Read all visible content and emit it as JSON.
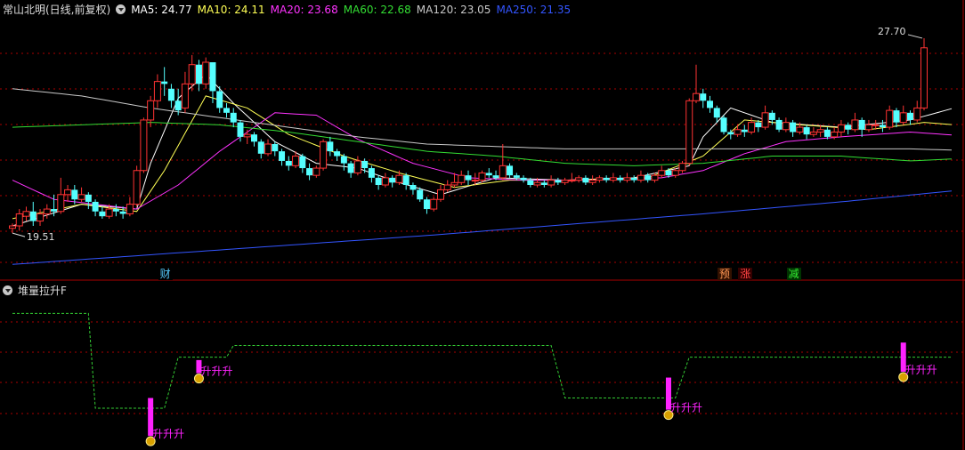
{
  "header": {
    "title": "常山北明(日线,前复权)",
    "ma": [
      {
        "label": "MA5: 24.77",
        "color": "#ffffff"
      },
      {
        "label": "MA10: 24.11",
        "color": "#ffff55"
      },
      {
        "label": "MA20: 23.68",
        "color": "#ff33ff"
      },
      {
        "label": "MA60: 22.68",
        "color": "#33dd33"
      },
      {
        "label": "MA120: 23.05",
        "color": "#c8c8c8"
      },
      {
        "label": "MA250: 21.35",
        "color": "#3355ff"
      }
    ]
  },
  "sub_header": {
    "title": "堆量拉升F"
  },
  "markers": [
    {
      "text": "财",
      "color": "#55ccff",
      "bg": "#000",
      "x_index": 22
    },
    {
      "text": "预",
      "color": "#ff9955",
      "bg": "#331100",
      "x_index": 103
    },
    {
      "text": "涨",
      "color": "#ff4444",
      "bg": "#330000",
      "x_index": 106
    },
    {
      "text": "减",
      "color": "#33ee33",
      "bg": "#003300",
      "x_index": 113
    }
  ],
  "annotations": {
    "high": "27.70",
    "low": "19.51",
    "signal_text": "升升升"
  },
  "colors": {
    "up": "#ff3333",
    "down": "#55ffff",
    "grid": "#aa0000",
    "ma5": "#ffffff",
    "ma10": "#ffff55",
    "ma20": "#ff33ff",
    "ma60": "#33dd33",
    "ma120": "#c8c8c8",
    "ma250": "#3355ff",
    "step": "#33cc33",
    "bar": "#ff22ff"
  },
  "chart_data": {
    "type": "candlestick",
    "price_range": [
      18.2,
      28.4
    ],
    "candles": [
      [
        19.8,
        19.9,
        20.0,
        19.6
      ],
      [
        19.9,
        20.4,
        20.6,
        19.7
      ],
      [
        20.3,
        20.5,
        20.7,
        20.1
      ],
      [
        20.5,
        20.1,
        20.9,
        19.9
      ],
      [
        20.1,
        20.4,
        20.6,
        19.9
      ],
      [
        20.4,
        20.6,
        20.8,
        20.2
      ],
      [
        20.6,
        20.5,
        21.2,
        20.3
      ],
      [
        20.5,
        21.2,
        21.9,
        20.4
      ],
      [
        21.2,
        21.4,
        21.6,
        20.9
      ],
      [
        21.4,
        21.0,
        21.6,
        20.8
      ],
      [
        21.0,
        21.2,
        21.5,
        20.9
      ],
      [
        21.2,
        20.9,
        21.3,
        20.6
      ],
      [
        20.9,
        20.5,
        21.0,
        20.3
      ],
      [
        20.5,
        20.3,
        20.7,
        20.2
      ],
      [
        20.3,
        20.6,
        20.8,
        20.2
      ],
      [
        20.6,
        20.5,
        20.8,
        20.3
      ],
      [
        20.5,
        20.4,
        20.7,
        20.2
      ],
      [
        20.4,
        20.8,
        21.1,
        20.3
      ],
      [
        20.8,
        22.2,
        22.4,
        20.7
      ],
      [
        22.2,
        24.3,
        24.4,
        22.1
      ],
      [
        24.3,
        25.1,
        25.3,
        24.0
      ],
      [
        25.1,
        25.9,
        26.2,
        24.8
      ],
      [
        25.9,
        25.8,
        26.5,
        25.3
      ],
      [
        25.6,
        25.1,
        25.8,
        24.8
      ],
      [
        25.1,
        24.7,
        25.6,
        24.5
      ],
      [
        24.8,
        25.8,
        26.3,
        24.6
      ],
      [
        25.8,
        26.6,
        27.0,
        25.5
      ],
      [
        26.6,
        25.8,
        26.8,
        25.5
      ],
      [
        25.8,
        26.7,
        26.9,
        25.6
      ],
      [
        26.7,
        25.5,
        26.7,
        25.0
      ],
      [
        25.5,
        24.8,
        25.7,
        24.6
      ],
      [
        24.8,
        24.6,
        25.0,
        24.4
      ],
      [
        24.6,
        24.2,
        24.8,
        24.0
      ],
      [
        24.2,
        23.6,
        24.3,
        23.4
      ],
      [
        23.6,
        23.7,
        23.9,
        23.3
      ],
      [
        23.7,
        23.4,
        23.8,
        23.2
      ],
      [
        23.4,
        22.9,
        23.5,
        22.7
      ],
      [
        22.9,
        23.3,
        23.5,
        22.8
      ],
      [
        23.3,
        23.0,
        23.4,
        22.8
      ],
      [
        23.0,
        22.6,
        23.1,
        22.4
      ],
      [
        22.6,
        22.4,
        22.8,
        22.2
      ],
      [
        22.4,
        22.8,
        23.0,
        22.3
      ],
      [
        22.8,
        22.3,
        22.9,
        22.1
      ],
      [
        22.3,
        22.0,
        22.5,
        21.8
      ],
      [
        22.0,
        22.3,
        22.4,
        21.9
      ],
      [
        22.3,
        23.4,
        23.5,
        22.2
      ],
      [
        23.4,
        23.0,
        23.6,
        22.8
      ],
      [
        23.0,
        22.8,
        23.1,
        22.6
      ],
      [
        22.8,
        22.5,
        22.9,
        22.2
      ],
      [
        22.5,
        22.1,
        22.6,
        21.9
      ],
      [
        22.1,
        22.6,
        22.8,
        22.0
      ],
      [
        22.6,
        22.3,
        22.7,
        22.1
      ],
      [
        22.3,
        21.9,
        22.4,
        21.7
      ],
      [
        21.9,
        21.6,
        22.0,
        21.4
      ],
      [
        21.6,
        21.9,
        22.1,
        21.5
      ],
      [
        21.9,
        21.7,
        22.0,
        21.5
      ],
      [
        21.7,
        22.0,
        22.2,
        21.6
      ],
      [
        22.0,
        21.6,
        22.1,
        21.4
      ],
      [
        21.6,
        21.4,
        21.7,
        21.2
      ],
      [
        21.4,
        21.0,
        21.5,
        20.9
      ],
      [
        21.0,
        20.6,
        21.1,
        20.4
      ],
      [
        20.6,
        21.0,
        21.1,
        20.5
      ],
      [
        21.0,
        21.4,
        21.6,
        20.9
      ],
      [
        21.4,
        21.6,
        21.8,
        21.3
      ],
      [
        21.6,
        21.7,
        22.1,
        21.5
      ],
      [
        21.7,
        22.0,
        22.2,
        21.6
      ],
      [
        22.0,
        21.8,
        22.2,
        21.6
      ],
      [
        21.8,
        21.8,
        22.1,
        21.6
      ],
      [
        21.8,
        22.1,
        22.2,
        21.7
      ],
      [
        22.1,
        22.0,
        22.3,
        21.9
      ],
      [
        22.0,
        21.9,
        22.2,
        21.8
      ],
      [
        21.9,
        22.4,
        23.3,
        21.8
      ],
      [
        22.4,
        22.0,
        22.5,
        21.9
      ],
      [
        22.0,
        21.9,
        22.1,
        21.8
      ],
      [
        21.9,
        21.8,
        22.0,
        21.7
      ],
      [
        21.8,
        21.6,
        21.9,
        21.5
      ],
      [
        21.6,
        21.7,
        21.9,
        21.5
      ],
      [
        21.7,
        21.6,
        21.8,
        21.5
      ],
      [
        21.6,
        21.8,
        22.0,
        21.5
      ],
      [
        21.8,
        21.7,
        21.9,
        21.6
      ],
      [
        21.7,
        21.8,
        21.9,
        21.6
      ],
      [
        21.8,
        21.8,
        22.1,
        21.7
      ],
      [
        21.8,
        21.9,
        22.0,
        21.7
      ],
      [
        21.9,
        21.7,
        22.0,
        21.6
      ],
      [
        21.7,
        21.8,
        22.0,
        21.6
      ],
      [
        21.8,
        21.9,
        22.0,
        21.7
      ],
      [
        21.9,
        21.8,
        22.0,
        21.7
      ],
      [
        21.8,
        21.9,
        22.1,
        21.7
      ],
      [
        21.9,
        21.8,
        22.0,
        21.7
      ],
      [
        21.8,
        21.9,
        22.1,
        21.7
      ],
      [
        21.9,
        21.8,
        22.0,
        21.7
      ],
      [
        21.8,
        22.0,
        22.2,
        21.7
      ],
      [
        22.0,
        21.8,
        22.1,
        21.7
      ],
      [
        21.8,
        22.0,
        22.1,
        21.7
      ],
      [
        22.0,
        22.2,
        22.4,
        21.9
      ],
      [
        22.2,
        22.0,
        22.3,
        21.9
      ],
      [
        22.0,
        22.2,
        22.3,
        21.9
      ],
      [
        22.2,
        22.5,
        22.6,
        22.1
      ],
      [
        22.5,
        25.1,
        25.2,
        22.4
      ],
      [
        25.1,
        25.4,
        26.6,
        25.0
      ],
      [
        25.4,
        25.1,
        25.6,
        24.8
      ],
      [
        25.1,
        24.8,
        25.3,
        24.6
      ],
      [
        24.8,
        24.4,
        24.9,
        24.2
      ],
      [
        24.4,
        23.8,
        24.5,
        23.7
      ],
      [
        23.8,
        23.7,
        23.9,
        23.5
      ],
      [
        23.7,
        23.9,
        24.1,
        23.6
      ],
      [
        23.9,
        23.8,
        24.1,
        23.6
      ],
      [
        23.8,
        24.2,
        24.4,
        23.7
      ],
      [
        24.2,
        24.0,
        24.3,
        23.8
      ],
      [
        24.0,
        24.6,
        24.9,
        23.9
      ],
      [
        24.6,
        24.3,
        24.7,
        24.1
      ],
      [
        24.3,
        23.9,
        24.4,
        23.8
      ],
      [
        23.9,
        24.2,
        24.4,
        23.8
      ],
      [
        24.2,
        23.8,
        24.3,
        23.6
      ],
      [
        23.8,
        24.0,
        24.2,
        23.7
      ],
      [
        24.0,
        23.7,
        24.1,
        23.5
      ],
      [
        23.7,
        23.8,
        24.0,
        23.6
      ],
      [
        23.8,
        23.9,
        24.1,
        23.6
      ],
      [
        23.9,
        23.6,
        24.0,
        23.5
      ],
      [
        23.6,
        23.8,
        24.0,
        23.5
      ],
      [
        23.8,
        24.1,
        24.3,
        23.6
      ],
      [
        24.1,
        23.9,
        24.2,
        23.7
      ],
      [
        23.9,
        24.3,
        24.6,
        23.8
      ],
      [
        24.3,
        23.9,
        24.4,
        23.6
      ],
      [
        23.9,
        24.1,
        24.3,
        23.8
      ],
      [
        24.1,
        24.1,
        24.3,
        23.9
      ],
      [
        24.1,
        24.0,
        24.3,
        23.8
      ],
      [
        24.0,
        24.7,
        24.9,
        23.9
      ],
      [
        24.7,
        24.2,
        24.8,
        24.0
      ],
      [
        24.2,
        24.6,
        24.9,
        24.1
      ],
      [
        24.6,
        24.3,
        24.7,
        24.1
      ],
      [
        24.3,
        24.8,
        25.1,
        24.2
      ],
      [
        24.8,
        27.3,
        27.7,
        24.7
      ]
    ],
    "ma_lines": [
      {
        "name": "MA5",
        "color": "#ffffff",
        "values": [
          [
            0,
            19.9
          ],
          [
            10,
            20.8
          ],
          [
            18,
            20.6
          ],
          [
            20,
            22.5
          ],
          [
            24,
            25.2
          ],
          [
            28,
            26.2
          ],
          [
            32,
            25.0
          ],
          [
            38,
            23.4
          ],
          [
            44,
            22.5
          ],
          [
            50,
            22.3
          ],
          [
            56,
            21.7
          ],
          [
            62,
            21.2
          ],
          [
            70,
            21.9
          ],
          [
            80,
            21.8
          ],
          [
            90,
            21.9
          ],
          [
            98,
            22.4
          ],
          [
            100,
            23.6
          ],
          [
            104,
            24.8
          ],
          [
            110,
            24.2
          ],
          [
            120,
            24.0
          ],
          [
            130,
            24.3
          ],
          [
            136,
            24.77
          ]
        ]
      },
      {
        "name": "MA10",
        "color": "#ffff55",
        "values": [
          [
            0,
            20.2
          ],
          [
            10,
            20.8
          ],
          [
            18,
            20.5
          ],
          [
            22,
            22.2
          ],
          [
            28,
            25.3
          ],
          [
            34,
            24.8
          ],
          [
            40,
            23.7
          ],
          [
            48,
            22.8
          ],
          [
            56,
            22.1
          ],
          [
            64,
            21.5
          ],
          [
            72,
            21.8
          ],
          [
            82,
            21.8
          ],
          [
            92,
            21.9
          ],
          [
            100,
            22.8
          ],
          [
            106,
            24.3
          ],
          [
            114,
            24.1
          ],
          [
            124,
            23.9
          ],
          [
            132,
            24.2
          ],
          [
            136,
            24.11
          ]
        ]
      },
      {
        "name": "MA20",
        "color": "#ff33ff",
        "values": [
          [
            0,
            21.8
          ],
          [
            6,
            21.0
          ],
          [
            12,
            20.8
          ],
          [
            18,
            20.6
          ],
          [
            24,
            21.6
          ],
          [
            30,
            23.0
          ],
          [
            38,
            24.6
          ],
          [
            44,
            24.5
          ],
          [
            50,
            23.5
          ],
          [
            58,
            22.5
          ],
          [
            66,
            21.9
          ],
          [
            74,
            21.8
          ],
          [
            84,
            21.8
          ],
          [
            94,
            21.9
          ],
          [
            100,
            22.2
          ],
          [
            106,
            22.9
          ],
          [
            112,
            23.4
          ],
          [
            120,
            23.6
          ],
          [
            130,
            23.8
          ],
          [
            136,
            23.68
          ]
        ]
      },
      {
        "name": "MA60",
        "color": "#33dd33",
        "values": [
          [
            0,
            24.0
          ],
          [
            10,
            24.1
          ],
          [
            20,
            24.2
          ],
          [
            30,
            24.1
          ],
          [
            40,
            23.8
          ],
          [
            50,
            23.4
          ],
          [
            60,
            23.0
          ],
          [
            70,
            22.8
          ],
          [
            80,
            22.5
          ],
          [
            90,
            22.4
          ],
          [
            100,
            22.5
          ],
          [
            110,
            22.8
          ],
          [
            120,
            22.8
          ],
          [
            130,
            22.6
          ],
          [
            136,
            22.68
          ]
        ]
      },
      {
        "name": "MA120",
        "color": "#c8c8c8",
        "values": [
          [
            0,
            25.6
          ],
          [
            10,
            25.3
          ],
          [
            20,
            24.8
          ],
          [
            30,
            24.4
          ],
          [
            40,
            24.0
          ],
          [
            50,
            23.6
          ],
          [
            60,
            23.3
          ],
          [
            70,
            23.2
          ],
          [
            80,
            23.1
          ],
          [
            90,
            23.1
          ],
          [
            100,
            23.1
          ],
          [
            110,
            23.1
          ],
          [
            120,
            23.1
          ],
          [
            130,
            23.1
          ],
          [
            136,
            23.05
          ]
        ]
      },
      {
        "name": "MA250",
        "color": "#3355ff",
        "values": [
          [
            0,
            18.3
          ],
          [
            20,
            18.7
          ],
          [
            40,
            19.1
          ],
          [
            60,
            19.5
          ],
          [
            80,
            19.95
          ],
          [
            100,
            20.4
          ],
          [
            120,
            20.9
          ],
          [
            136,
            21.35
          ]
        ]
      }
    ],
    "indicator": {
      "range": [
        0,
        10
      ],
      "step_line": [
        [
          0,
          9.0
        ],
        [
          11,
          9.0
        ],
        [
          12,
          2.5
        ],
        [
          22,
          2.5
        ],
        [
          24,
          6.0
        ],
        [
          31,
          6.0
        ],
        [
          32,
          6.8
        ],
        [
          78,
          6.8
        ],
        [
          80,
          3.2
        ],
        [
          96,
          3.2
        ],
        [
          98,
          6.0
        ],
        [
          136,
          6.0
        ]
      ],
      "signals": [
        {
          "index": 20,
          "from": 0.6,
          "to": 3.2
        },
        {
          "index": 27,
          "from": 4.9,
          "to": 5.8
        },
        {
          "index": 95,
          "from": 2.4,
          "to": 4.6
        },
        {
          "index": 129,
          "from": 5.0,
          "to": 7.0
        }
      ]
    }
  }
}
